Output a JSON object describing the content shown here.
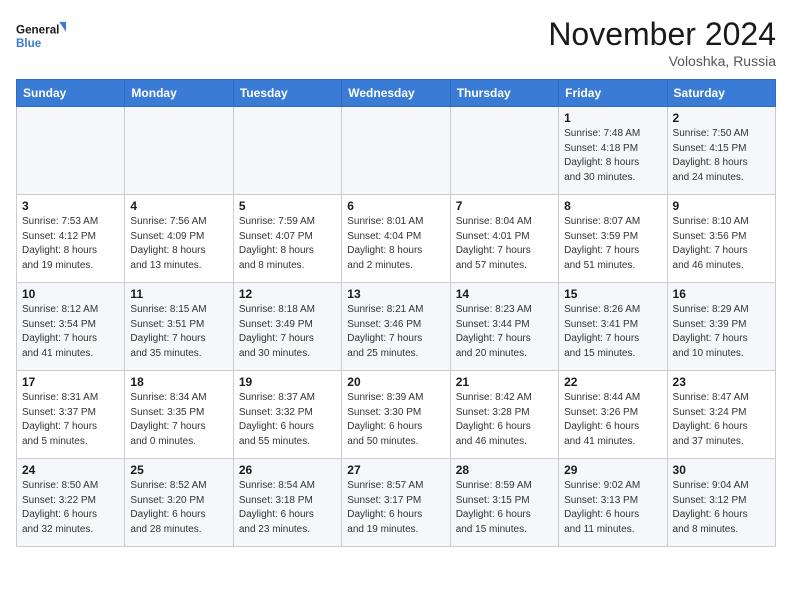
{
  "logo": {
    "line1": "General",
    "line2": "Blue"
  },
  "title": "November 2024",
  "location": "Voloshka, Russia",
  "days_header": [
    "Sunday",
    "Monday",
    "Tuesday",
    "Wednesday",
    "Thursday",
    "Friday",
    "Saturday"
  ],
  "weeks": [
    [
      {
        "day": "",
        "info": ""
      },
      {
        "day": "",
        "info": ""
      },
      {
        "day": "",
        "info": ""
      },
      {
        "day": "",
        "info": ""
      },
      {
        "day": "",
        "info": ""
      },
      {
        "day": "1",
        "info": "Sunrise: 7:48 AM\nSunset: 4:18 PM\nDaylight: 8 hours\nand 30 minutes."
      },
      {
        "day": "2",
        "info": "Sunrise: 7:50 AM\nSunset: 4:15 PM\nDaylight: 8 hours\nand 24 minutes."
      }
    ],
    [
      {
        "day": "3",
        "info": "Sunrise: 7:53 AM\nSunset: 4:12 PM\nDaylight: 8 hours\nand 19 minutes."
      },
      {
        "day": "4",
        "info": "Sunrise: 7:56 AM\nSunset: 4:09 PM\nDaylight: 8 hours\nand 13 minutes."
      },
      {
        "day": "5",
        "info": "Sunrise: 7:59 AM\nSunset: 4:07 PM\nDaylight: 8 hours\nand 8 minutes."
      },
      {
        "day": "6",
        "info": "Sunrise: 8:01 AM\nSunset: 4:04 PM\nDaylight: 8 hours\nand 2 minutes."
      },
      {
        "day": "7",
        "info": "Sunrise: 8:04 AM\nSunset: 4:01 PM\nDaylight: 7 hours\nand 57 minutes."
      },
      {
        "day": "8",
        "info": "Sunrise: 8:07 AM\nSunset: 3:59 PM\nDaylight: 7 hours\nand 51 minutes."
      },
      {
        "day": "9",
        "info": "Sunrise: 8:10 AM\nSunset: 3:56 PM\nDaylight: 7 hours\nand 46 minutes."
      }
    ],
    [
      {
        "day": "10",
        "info": "Sunrise: 8:12 AM\nSunset: 3:54 PM\nDaylight: 7 hours\nand 41 minutes."
      },
      {
        "day": "11",
        "info": "Sunrise: 8:15 AM\nSunset: 3:51 PM\nDaylight: 7 hours\nand 35 minutes."
      },
      {
        "day": "12",
        "info": "Sunrise: 8:18 AM\nSunset: 3:49 PM\nDaylight: 7 hours\nand 30 minutes."
      },
      {
        "day": "13",
        "info": "Sunrise: 8:21 AM\nSunset: 3:46 PM\nDaylight: 7 hours\nand 25 minutes."
      },
      {
        "day": "14",
        "info": "Sunrise: 8:23 AM\nSunset: 3:44 PM\nDaylight: 7 hours\nand 20 minutes."
      },
      {
        "day": "15",
        "info": "Sunrise: 8:26 AM\nSunset: 3:41 PM\nDaylight: 7 hours\nand 15 minutes."
      },
      {
        "day": "16",
        "info": "Sunrise: 8:29 AM\nSunset: 3:39 PM\nDaylight: 7 hours\nand 10 minutes."
      }
    ],
    [
      {
        "day": "17",
        "info": "Sunrise: 8:31 AM\nSunset: 3:37 PM\nDaylight: 7 hours\nand 5 minutes."
      },
      {
        "day": "18",
        "info": "Sunrise: 8:34 AM\nSunset: 3:35 PM\nDaylight: 7 hours\nand 0 minutes."
      },
      {
        "day": "19",
        "info": "Sunrise: 8:37 AM\nSunset: 3:32 PM\nDaylight: 6 hours\nand 55 minutes."
      },
      {
        "day": "20",
        "info": "Sunrise: 8:39 AM\nSunset: 3:30 PM\nDaylight: 6 hours\nand 50 minutes."
      },
      {
        "day": "21",
        "info": "Sunrise: 8:42 AM\nSunset: 3:28 PM\nDaylight: 6 hours\nand 46 minutes."
      },
      {
        "day": "22",
        "info": "Sunrise: 8:44 AM\nSunset: 3:26 PM\nDaylight: 6 hours\nand 41 minutes."
      },
      {
        "day": "23",
        "info": "Sunrise: 8:47 AM\nSunset: 3:24 PM\nDaylight: 6 hours\nand 37 minutes."
      }
    ],
    [
      {
        "day": "24",
        "info": "Sunrise: 8:50 AM\nSunset: 3:22 PM\nDaylight: 6 hours\nand 32 minutes."
      },
      {
        "day": "25",
        "info": "Sunrise: 8:52 AM\nSunset: 3:20 PM\nDaylight: 6 hours\nand 28 minutes."
      },
      {
        "day": "26",
        "info": "Sunrise: 8:54 AM\nSunset: 3:18 PM\nDaylight: 6 hours\nand 23 minutes."
      },
      {
        "day": "27",
        "info": "Sunrise: 8:57 AM\nSunset: 3:17 PM\nDaylight: 6 hours\nand 19 minutes."
      },
      {
        "day": "28",
        "info": "Sunrise: 8:59 AM\nSunset: 3:15 PM\nDaylight: 6 hours\nand 15 minutes."
      },
      {
        "day": "29",
        "info": "Sunrise: 9:02 AM\nSunset: 3:13 PM\nDaylight: 6 hours\nand 11 minutes."
      },
      {
        "day": "30",
        "info": "Sunrise: 9:04 AM\nSunset: 3:12 PM\nDaylight: 6 hours\nand 8 minutes."
      }
    ]
  ]
}
